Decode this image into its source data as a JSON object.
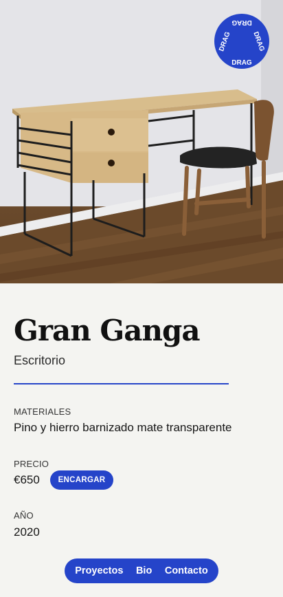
{
  "hero": {
    "image_alt_icon": "desk-photo",
    "badge_text": "DRAG"
  },
  "product": {
    "title": "Gran Ganga",
    "category": "Escritorio"
  },
  "details": {
    "materials_label": "MATERIALES",
    "materials_value": "Pino y hierro barnizado mate transparente",
    "price_label": "PRECIO",
    "price_value": "€650",
    "order_button": "ENCARGAR",
    "year_label": "AÑO",
    "year_value": "2020"
  },
  "nav": {
    "items": [
      "Proyectos",
      "Bio",
      "Contacto"
    ]
  },
  "colors": {
    "accent": "#2544c9",
    "background": "#f4f4f1"
  }
}
